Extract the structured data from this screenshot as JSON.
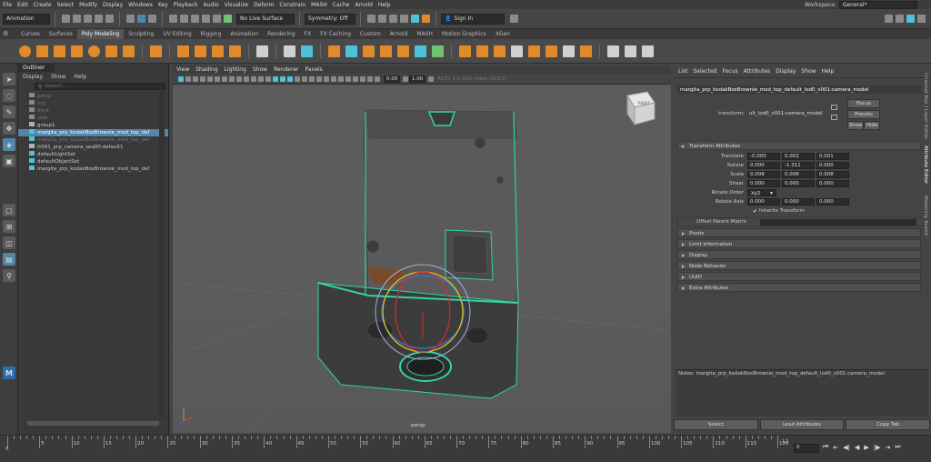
{
  "menubar": {
    "items": [
      "File",
      "Edit",
      "Create",
      "Select",
      "Modify",
      "Display",
      "Windows",
      "Key",
      "Playback",
      "Audio",
      "Visualize",
      "Deform",
      "Constrain",
      "MASH",
      "Cache",
      "Arnold",
      "Help"
    ],
    "workspace_label": "Workspace:",
    "workspace_value": "General*"
  },
  "statusline": {
    "mode": "Animation",
    "live_surface": "No Live Surface",
    "symmetry": "Symmetry: Off",
    "sign_in": "Sign In"
  },
  "shelf_tabs": [
    "Curves",
    "Surfaces",
    "Poly Modeling",
    "Sculpting",
    "UV Editing",
    "Rigging",
    "Animation",
    "Rendering",
    "FX",
    "FX Caching",
    "Custom",
    "Arnold",
    "MASH",
    "Motion Graphics",
    "XGen"
  ],
  "shelf_active": "Poly Modeling",
  "outliner": {
    "title": "Outliner",
    "menu": [
      "Display",
      "Show",
      "Help"
    ],
    "search_placeholder": "Search...",
    "items": [
      {
        "label": "persp",
        "dim": true
      },
      {
        "label": "top",
        "dim": true
      },
      {
        "label": "front",
        "dim": true
      },
      {
        "label": "side",
        "dim": true
      },
      {
        "label": "group1",
        "dim": false
      },
      {
        "label": "margita_prp_kodakBoxBrownie_mod_top_def",
        "dim": false,
        "selected": true
      },
      {
        "label": "margita_prp_kodakBoxBrownie_mod_top_def",
        "dim": true
      },
      {
        "label": "tt041_prp_camera_seq00:default1",
        "dim": false
      },
      {
        "label": "defaultLightSet",
        "dim": false
      },
      {
        "label": "defaultObjectSet",
        "dim": false
      },
      {
        "label": "margita_prp_kodakBoxBrownie_mod_top_def",
        "dim": false
      }
    ]
  },
  "viewport": {
    "menu": [
      "View",
      "Shading",
      "Lighting",
      "Show",
      "Renderer",
      "Panels"
    ],
    "field1": "0.00",
    "field2": "1.00",
    "colorspace": "ACES 1.0 SDR-video (ACES)",
    "camera_label": "persp",
    "viewcube_label": "RIGHT"
  },
  "attribute_editor": {
    "menu": [
      "List",
      "Selected",
      "Focus",
      "Attributes",
      "Display",
      "Show",
      "Help"
    ],
    "node_tab": "margita_prp_kodakBoxBrownie_mod_top_default_lod0_v001:camera_model",
    "transform_label": "transform:",
    "transform_value": "ult_lod0_v001:camera_model",
    "focus": "Focus",
    "presets": "Presets",
    "show": "Show",
    "hide": "Hide",
    "transform_attrs_title": "Transform Attributes",
    "fields": [
      {
        "label": "Translate",
        "values": [
          "-0.000",
          "0.002",
          "0.001"
        ]
      },
      {
        "label": "Rotate",
        "values": [
          "0.000",
          "-1.311",
          "0.000"
        ]
      },
      {
        "label": "Scale",
        "values": [
          "0.008",
          "0.008",
          "0.008"
        ]
      },
      {
        "label": "Shear",
        "values": [
          "0.000",
          "0.000",
          "0.000"
        ]
      }
    ],
    "rotate_order_label": "Rotate Order",
    "rotate_order_value": "xyz",
    "rotate_axis_label": "Rotate Axis",
    "rotate_axis_values": [
      "0.000",
      "0.000",
      "0.000"
    ],
    "inherits_transform": "Inherits Transform",
    "offset_parent": "Offset Parent Matrix",
    "sections": [
      "Pivots",
      "Limit Information",
      "Display",
      "Node Behavior",
      "UUID",
      "Extra Attributes"
    ],
    "notes_label": "Notes: margita_prp_kodakBoxBrownie_mod_top_default_lod0_v001:camera_model",
    "bottom_buttons": [
      "Select",
      "Load Attributes",
      "Copy Tab"
    ]
  },
  "side_tabs": [
    "Channel Box / Layer Editor",
    "Attribute Editor",
    "Modeling Toolkit"
  ],
  "timeline": {
    "ticks": [
      "5",
      "10",
      "15",
      "20",
      "25",
      "30",
      "35",
      "40",
      "45",
      "50",
      "55",
      "60",
      "65",
      "70",
      "75",
      "80",
      "85",
      "90",
      "95",
      "100",
      "105",
      "110",
      "115",
      "120"
    ],
    "start_label": "0",
    "end_label": "12",
    "current_frame": "0"
  },
  "mel_label": "M"
}
